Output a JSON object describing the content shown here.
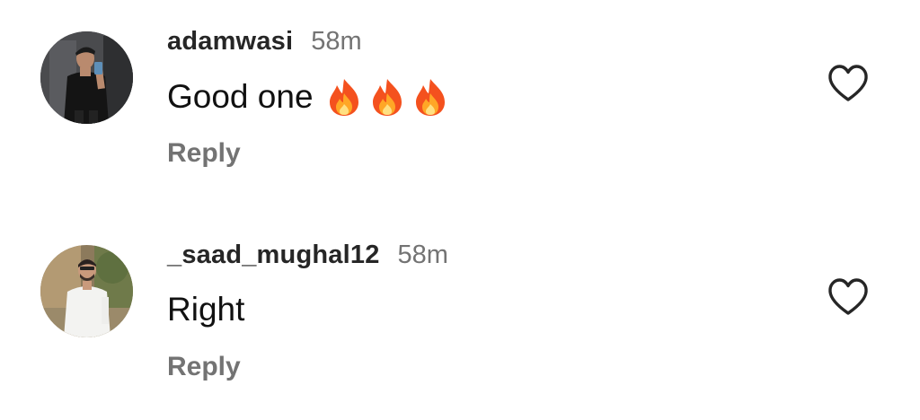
{
  "comments": [
    {
      "username": "adamwasi",
      "time": "58m",
      "text": "Good one",
      "emojis": [
        "fire",
        "fire",
        "fire"
      ],
      "reply_label": "Reply",
      "avatar_icon": "avatar-photo-man-black-shirt",
      "like_icon": "heart-outline-icon"
    },
    {
      "username": "_saad_mughal12",
      "time": "58m",
      "text": "Right",
      "emojis": [],
      "reply_label": "Reply",
      "avatar_icon": "avatar-photo-man-white-kurta",
      "like_icon": "heart-outline-icon"
    }
  ],
  "colors": {
    "username": "#262626",
    "timestamp": "#737373",
    "text": "#111111",
    "reply": "#737373",
    "heart_stroke": "#262626"
  }
}
